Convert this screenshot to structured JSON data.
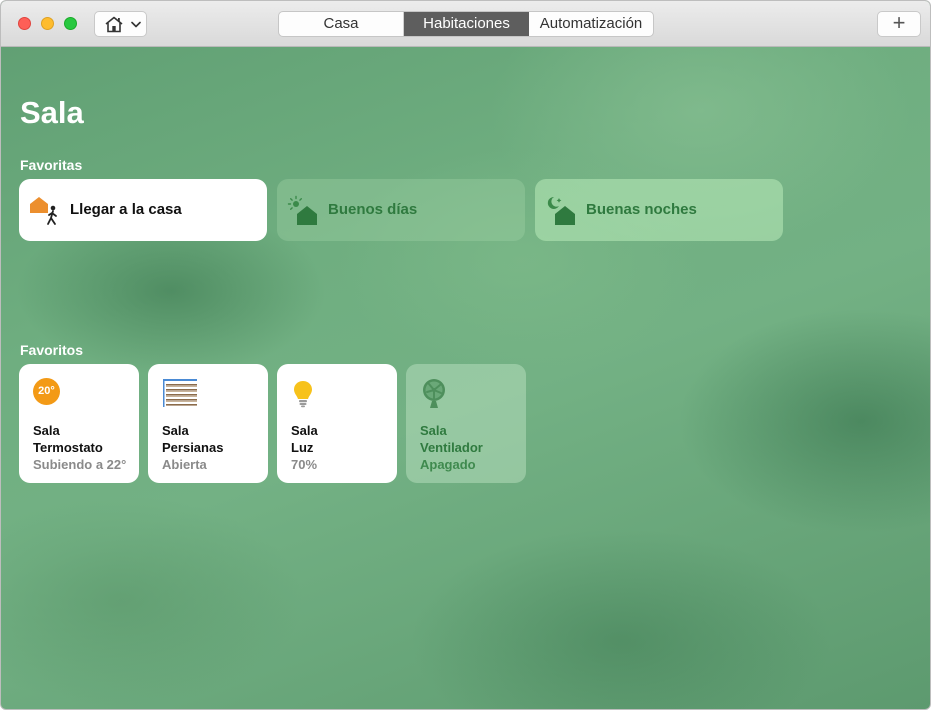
{
  "toolbar": {
    "home_icon": "house-icon",
    "chevron_icon": "chevron-down-icon",
    "tabs": [
      {
        "label": "Casa"
      },
      {
        "label": "Habitaciones",
        "selected": true
      },
      {
        "label": "Automatización"
      }
    ],
    "add_label": "+"
  },
  "room": {
    "title": "Sala"
  },
  "scenes": {
    "section_label": "Favoritas",
    "items": [
      {
        "label": "Llegar a la casa",
        "icon": "arrive-home-icon",
        "active": true
      },
      {
        "label": "Buenos días",
        "icon": "good-morning-icon",
        "active": false
      },
      {
        "label": "Buenas noches",
        "icon": "good-night-icon",
        "active": false
      }
    ]
  },
  "accessories": {
    "section_label": "Favoritos",
    "items": [
      {
        "room": "Sala",
        "name": "Termostato",
        "status": "Subiendo a 22°",
        "icon": "thermostat-icon",
        "badge": "20°",
        "active": true
      },
      {
        "room": "Sala",
        "name": "Persianas",
        "status": "Abierta",
        "icon": "blinds-icon",
        "active": true
      },
      {
        "room": "Sala",
        "name": "Luz",
        "status": "70%",
        "icon": "lightbulb-icon",
        "active": true
      },
      {
        "room": "Sala",
        "name": "Ventilador",
        "status": "Apagado",
        "icon": "fan-icon",
        "active": false
      }
    ]
  },
  "colors": {
    "thermostat_accent": "#f39a16",
    "light_accent": "#f7c21b",
    "scene_text_inactive": "#2f7a3f",
    "selected_tab": "#5e5e5e"
  }
}
